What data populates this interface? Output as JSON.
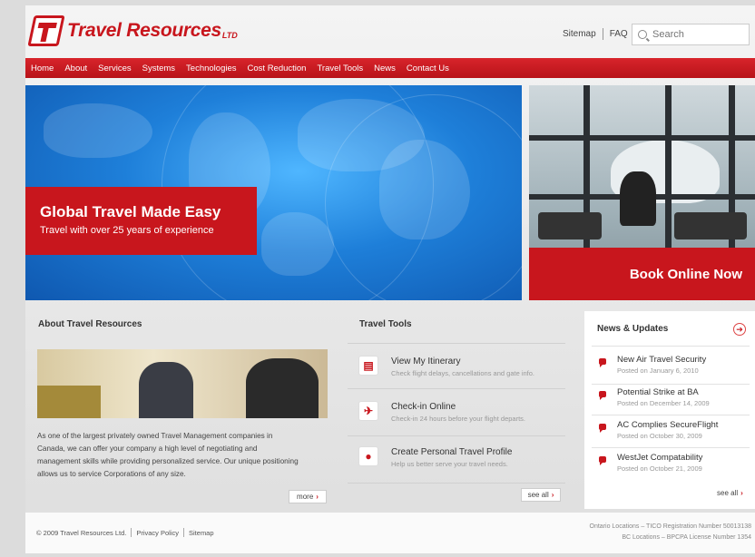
{
  "header": {
    "logo_text": "Travel Resources",
    "logo_suffix": "LTD",
    "links": [
      "Sitemap",
      "FAQ"
    ],
    "search_placeholder": "Search"
  },
  "nav": [
    "Home",
    "About",
    "Services",
    "Systems",
    "Technologies",
    "Cost Reduction",
    "Travel Tools",
    "News",
    "Contact Us"
  ],
  "hero": {
    "title": "Global Travel Made Easy",
    "subtitle": "Travel with over 25 years of experience"
  },
  "booking": {
    "label": "Book Online Now"
  },
  "about": {
    "title": "About Travel Resources",
    "lines": [
      "As one of the largest privately owned Travel Management companies in",
      "Canada, we can offer your company a high level of negotiating and",
      "management skills while providing personalized service. Our unique positioning",
      "allows us to service Corporations of any size."
    ],
    "more_label": "more"
  },
  "tools": {
    "title": "Travel Tools",
    "items": [
      {
        "title": "View My Itinerary",
        "desc": "Check flight delays, cancellations and gate info.",
        "icon": "itinerary-icon"
      },
      {
        "title": "Check-in Online",
        "desc": "Check-in 24 hours before your flight departs.",
        "icon": "plane-icon"
      },
      {
        "title": "Create Personal Travel Profile",
        "desc": "Help us better serve your travel needs.",
        "icon": "profile-icon"
      }
    ],
    "see_all": "see all"
  },
  "news": {
    "title": "News & Updates",
    "items": [
      {
        "title": "New Air Travel Security",
        "date": "Posted on January 6, 2010"
      },
      {
        "title": "Potential Strike at BA",
        "date": "Posted on December 14, 2009"
      },
      {
        "title": "AC Complies SecureFlight",
        "date": "Posted on October 30, 2009"
      },
      {
        "title": "WestJet Compatability",
        "date": "Posted on October 21, 2009"
      }
    ],
    "see_all": "see all"
  },
  "footer": {
    "copyright": "© 2009 Travel Resources Ltd.",
    "links": [
      "Privacy Policy",
      "Sitemap"
    ],
    "ontario": "Ontario Locations – TICO Registration Number 50013138",
    "bc": "BC Locations – BPCPA License Number 1354"
  },
  "colors": {
    "brand_red": "#c8161d",
    "hero_blue": "#1e7fd9"
  }
}
